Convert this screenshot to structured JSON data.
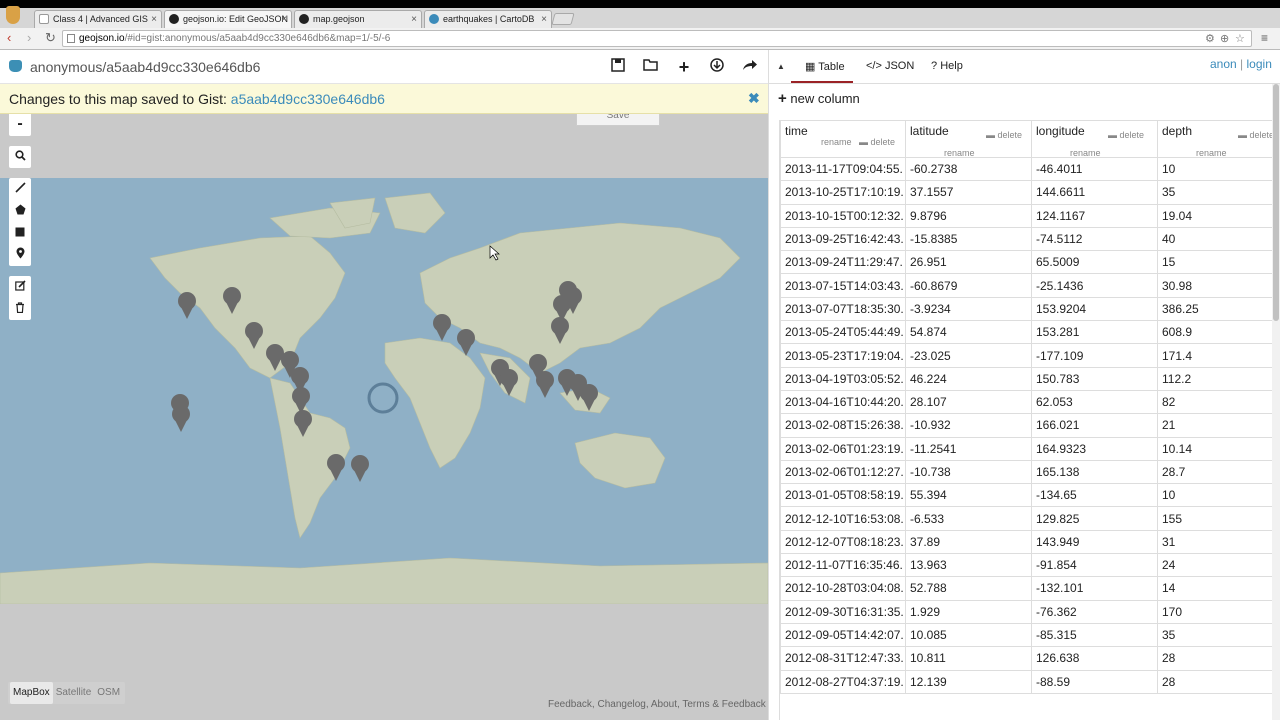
{
  "browser": {
    "tabs": [
      {
        "label": "Class 4 | Advanced GIS",
        "icon": "page-icon",
        "color": "#ffffff"
      },
      {
        "label": "geojson.io: Edit GeoJSON",
        "icon": "github-icon",
        "color": "#222222"
      },
      {
        "label": "map.geojson",
        "icon": "github-icon",
        "color": "#222222"
      },
      {
        "label": "earthquakes | CartoDB",
        "icon": "cartodb-icon",
        "color": "#3b8bba"
      }
    ],
    "url_host": "geojson.io",
    "url_rest": "/#id=gist:anonymous/a5aab4d9cc330e646db6&map=1/-5/-6"
  },
  "header": {
    "title": "anonymous/a5aab4d9cc330e646db6",
    "tools": [
      "save-icon",
      "open-icon",
      "new-icon",
      "download-icon",
      "share-icon"
    ]
  },
  "notice": {
    "text": "Changes to this map saved to Gist: ",
    "link": "a5aab4d9cc330e646db6",
    "close": "✖"
  },
  "map": {
    "save_label": "Save",
    "zoom_out": "-",
    "layers": [
      "MapBox",
      "Satellite",
      "OSM"
    ],
    "active_layer": "MapBox",
    "footer": "Feedback, Changelog, About, Terms & Feedback"
  },
  "panel": {
    "tabs": [
      {
        "label": "Table",
        "icon": "table-icon"
      },
      {
        "label": "JSON",
        "icon": "code-icon"
      },
      {
        "label": "Help",
        "icon": "question-icon"
      }
    ],
    "active_tab": "Table",
    "auth_anon": "anon",
    "auth_sep": "|",
    "auth_login": "login",
    "new_column": "new column",
    "rename": "rename",
    "delete": "delete",
    "columns": [
      "time",
      "latitude",
      "longitude",
      "depth"
    ],
    "rows": [
      [
        "2013-11-17T09:04:55.",
        "-60.2738",
        "-46.4011",
        "10"
      ],
      [
        "2013-10-25T17:10:19.",
        "37.1557",
        "144.6611",
        "35"
      ],
      [
        "2013-10-15T00:12:32.",
        "9.8796",
        "124.1167",
        "19.04"
      ],
      [
        "2013-09-25T16:42:43.",
        "-15.8385",
        "-74.5112",
        "40"
      ],
      [
        "2013-09-24T11:29:47.",
        "26.951",
        "65.5009",
        "15"
      ],
      [
        "2013-07-15T14:03:43.",
        "-60.8679",
        "-25.1436",
        "30.98"
      ],
      [
        "2013-07-07T18:35:30.",
        "-3.9234",
        "153.9204",
        "386.25"
      ],
      [
        "2013-05-24T05:44:49.",
        "54.874",
        "153.281",
        "608.9"
      ],
      [
        "2013-05-23T17:19:04.",
        "-23.025",
        "-177.109",
        "171.4"
      ],
      [
        "2013-04-19T03:05:52.",
        "46.224",
        "150.783",
        "112.2"
      ],
      [
        "2013-04-16T10:44:20.",
        "28.107",
        "62.053",
        "82"
      ],
      [
        "2013-02-08T15:26:38.",
        "-10.932",
        "166.021",
        "21"
      ],
      [
        "2013-02-06T01:23:19.",
        "-11.2541",
        "164.9323",
        "10.14"
      ],
      [
        "2013-02-06T01:12:27.",
        "-10.738",
        "165.138",
        "28.7"
      ],
      [
        "2013-01-05T08:58:19.",
        "55.394",
        "-134.65",
        "10"
      ],
      [
        "2012-12-10T16:53:08.",
        "-6.533",
        "129.825",
        "155"
      ],
      [
        "2012-12-07T08:18:23.",
        "37.89",
        "143.949",
        "31"
      ],
      [
        "2012-11-07T16:35:46.",
        "13.963",
        "-91.854",
        "24"
      ],
      [
        "2012-10-28T03:04:08.",
        "52.788",
        "-132.101",
        "14"
      ],
      [
        "2012-09-30T16:31:35.",
        "1.929",
        "-76.362",
        "170"
      ],
      [
        "2012-09-05T14:42:07.",
        "10.085",
        "-85.315",
        "35"
      ],
      [
        "2012-08-31T12:47:33.",
        "10.811",
        "126.638",
        "28"
      ],
      [
        "2012-08-27T04:37:19.",
        "12.139",
        "-88.59",
        "28"
      ]
    ]
  },
  "colors": {
    "accent": "#3b8bba",
    "notice_bg": "#fbf9d9",
    "ocean": "#8fb0c6",
    "land": "#c9cfb8",
    "marker": "#6a6a6a",
    "tab_underline": "#9b2226"
  }
}
